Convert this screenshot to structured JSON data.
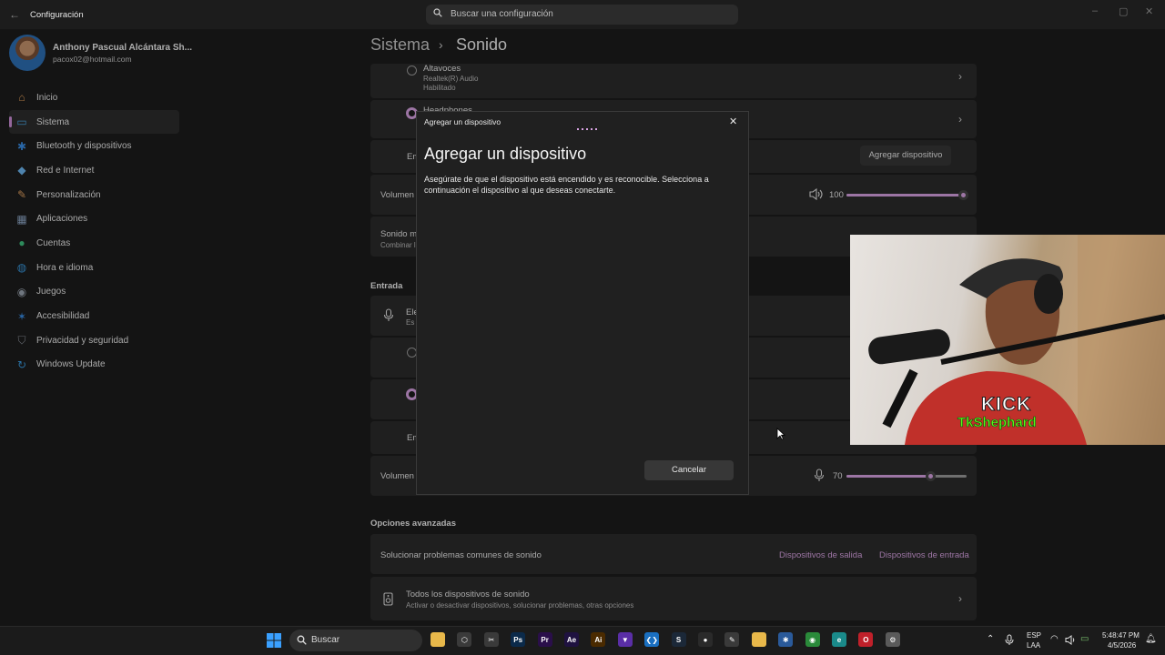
{
  "window": {
    "app_title": "Configuración",
    "search_placeholder": "Buscar una configuración"
  },
  "user": {
    "name": "Anthony Pascual Alcántara Sh...",
    "email": "pacox02@hotmail.com"
  },
  "sidebar": {
    "items": [
      {
        "label": "Inicio",
        "icon": "home-icon",
        "color": "#e8a15c"
      },
      {
        "label": "Sistema",
        "icon": "system-icon",
        "color": "#4aa3df",
        "active": true
      },
      {
        "label": "Bluetooth y dispositivos",
        "icon": "bluetooth-icon",
        "color": "#3a8ee6"
      },
      {
        "label": "Red e Internet",
        "icon": "wifi-icon",
        "color": "#6cb6f0"
      },
      {
        "label": "Personalización",
        "icon": "brush-icon",
        "color": "#e0a060"
      },
      {
        "label": "Aplicaciones",
        "icon": "apps-icon",
        "color": "#8fa8c8"
      },
      {
        "label": "Cuentas",
        "icon": "account-icon",
        "color": "#3fbf7f"
      },
      {
        "label": "Hora e idioma",
        "icon": "globe-icon",
        "color": "#3a9ae0"
      },
      {
        "label": "Juegos",
        "icon": "gamepad-icon",
        "color": "#9aa4b0"
      },
      {
        "label": "Accesibilidad",
        "icon": "accessibility-icon",
        "color": "#3a8ee6"
      },
      {
        "label": "Privacidad y seguridad",
        "icon": "shield-icon",
        "color": "#8a8f98"
      },
      {
        "label": "Windows Update",
        "icon": "update-icon",
        "color": "#3a9ae0"
      }
    ]
  },
  "breadcrumb": {
    "parent": "Sistema",
    "separator": "›",
    "current": "Sonido"
  },
  "output": {
    "devices": [
      {
        "name": "Altavoces",
        "detail": "Realtek(R) Audio",
        "status": "Habilitado",
        "selected": false
      },
      {
        "name": "Headphones",
        "selected": true
      }
    ],
    "pair_row_label": "Em",
    "add_device_button": "Agregar dispositivo",
    "volume_label": "Volumen",
    "volume_value": "100",
    "volume_level": 1.0,
    "mono_label": "Sonido m",
    "mono_sub": "Combinar l"
  },
  "input": {
    "section_title": "Entrada",
    "choose_label": "Ele",
    "choose_sub": "Es",
    "pair_row_label": "Em",
    "volume_label": "Volumen",
    "volume_value": "70",
    "volume_level": 0.7
  },
  "advanced": {
    "section_title": "Opciones avanzadas",
    "troubleshoot_label": "Solucionar problemas comunes de sonido",
    "output_devices_link": "Dispositivos de salida",
    "input_devices_link": "Dispositivos de entrada",
    "all_devices_title": "Todos los dispositivos de sonido",
    "all_devices_sub": "Activar o desactivar dispositivos, solucionar problemas, otras opciones"
  },
  "dialog": {
    "window_title": "Agregar un dispositivo",
    "heading": "Agregar un dispositivo",
    "description": "Asegúrate de que el dispositivo está encendido y es reconocible. Selecciona a continuación el dispositivo al que deseas conectarte.",
    "cancel_button": "Cancelar"
  },
  "webcam": {
    "brand": "KICK",
    "channel": "TkShephard"
  },
  "taskbar": {
    "search_label": "Buscar",
    "apps": [
      {
        "name": "file-explorer-icon",
        "text": "",
        "color": "#e8b84a"
      },
      {
        "name": "app-hex-icon",
        "text": "⬡",
        "color": "#3a3a3a"
      },
      {
        "name": "capcut-icon",
        "text": "✂",
        "color": "#3a3a3a"
      },
      {
        "name": "photoshop-icon",
        "text": "Ps",
        "color": "#0b2a4a"
      },
      {
        "name": "premiere-icon",
        "text": "Pr",
        "color": "#2a0f4a"
      },
      {
        "name": "after-effects-icon",
        "text": "Ae",
        "color": "#1f1240"
      },
      {
        "name": "illustrator-icon",
        "text": "Ai",
        "color": "#4a2a00"
      },
      {
        "name": "vpn-icon",
        "text": "▼",
        "color": "#5a2ea6"
      },
      {
        "name": "vscode-icon",
        "text": "❮❯",
        "color": "#1a6fc0"
      },
      {
        "name": "steam-icon",
        "text": "S",
        "color": "#1b2838"
      },
      {
        "name": "obs-icon",
        "text": "●",
        "color": "#2a2a2a"
      },
      {
        "name": "notes-icon",
        "text": "✎",
        "color": "#3a3a3a"
      },
      {
        "name": "folder-icon",
        "text": "",
        "color": "#e8b84a"
      },
      {
        "name": "settings-gear-icon",
        "text": "✱",
        "color": "#2a5a9a"
      },
      {
        "name": "chrome-icon",
        "text": "◉",
        "color": "#2a8a3a"
      },
      {
        "name": "edge-icon",
        "text": "e",
        "color": "#1a8a8a"
      },
      {
        "name": "opera-icon",
        "text": "O",
        "color": "#c0202a"
      },
      {
        "name": "settings-app-icon",
        "text": "⚙",
        "color": "#5a5a5a"
      }
    ],
    "lang_top": "ESP",
    "lang_bottom": "LAA",
    "time": "5:48:47 PM",
    "date": "4/5/2026"
  }
}
